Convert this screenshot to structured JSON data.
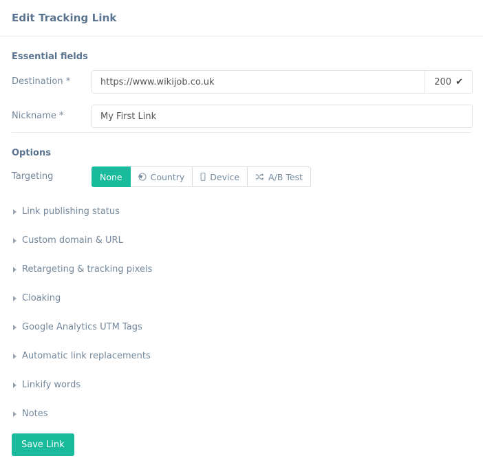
{
  "header": {
    "title": "Edit Tracking Link"
  },
  "essential": {
    "heading": "Essential fields",
    "destination": {
      "label": "Destination *",
      "value": "https://www.wikijob.co.uk",
      "placeholder": "https://www.wikijob.co.uk",
      "status_code": "200",
      "status_icon": "check-icon"
    },
    "nickname": {
      "label": "Nickname *",
      "value": "My First Link",
      "placeholder": "My First Link"
    }
  },
  "options": {
    "heading": "Options",
    "targeting": {
      "label": "Targeting",
      "selected": "None",
      "buttons": [
        {
          "label": "None",
          "icon": "",
          "active": true
        },
        {
          "label": "Country",
          "icon": "globe-icon",
          "active": false
        },
        {
          "label": "Device",
          "icon": "mobile-icon",
          "active": false
        },
        {
          "label": "A/B Test",
          "icon": "shuffle-icon",
          "active": false
        }
      ]
    }
  },
  "accordion": {
    "items": [
      {
        "label": "Link publishing status"
      },
      {
        "label": "Custom domain & URL"
      },
      {
        "label": "Retargeting & tracking pixels"
      },
      {
        "label": "Cloaking"
      },
      {
        "label": "Google Analytics UTM Tags"
      },
      {
        "label": "Automatic link replacements"
      },
      {
        "label": "Linkify words"
      },
      {
        "label": "Notes"
      }
    ]
  },
  "actions": {
    "save_label": "Save Link"
  },
  "colors": {
    "accent": "#1ABB9C",
    "text": "#73879C",
    "heading": "#5A738E",
    "border": "#E6E9ED",
    "input_border": "#E1E3E6"
  }
}
